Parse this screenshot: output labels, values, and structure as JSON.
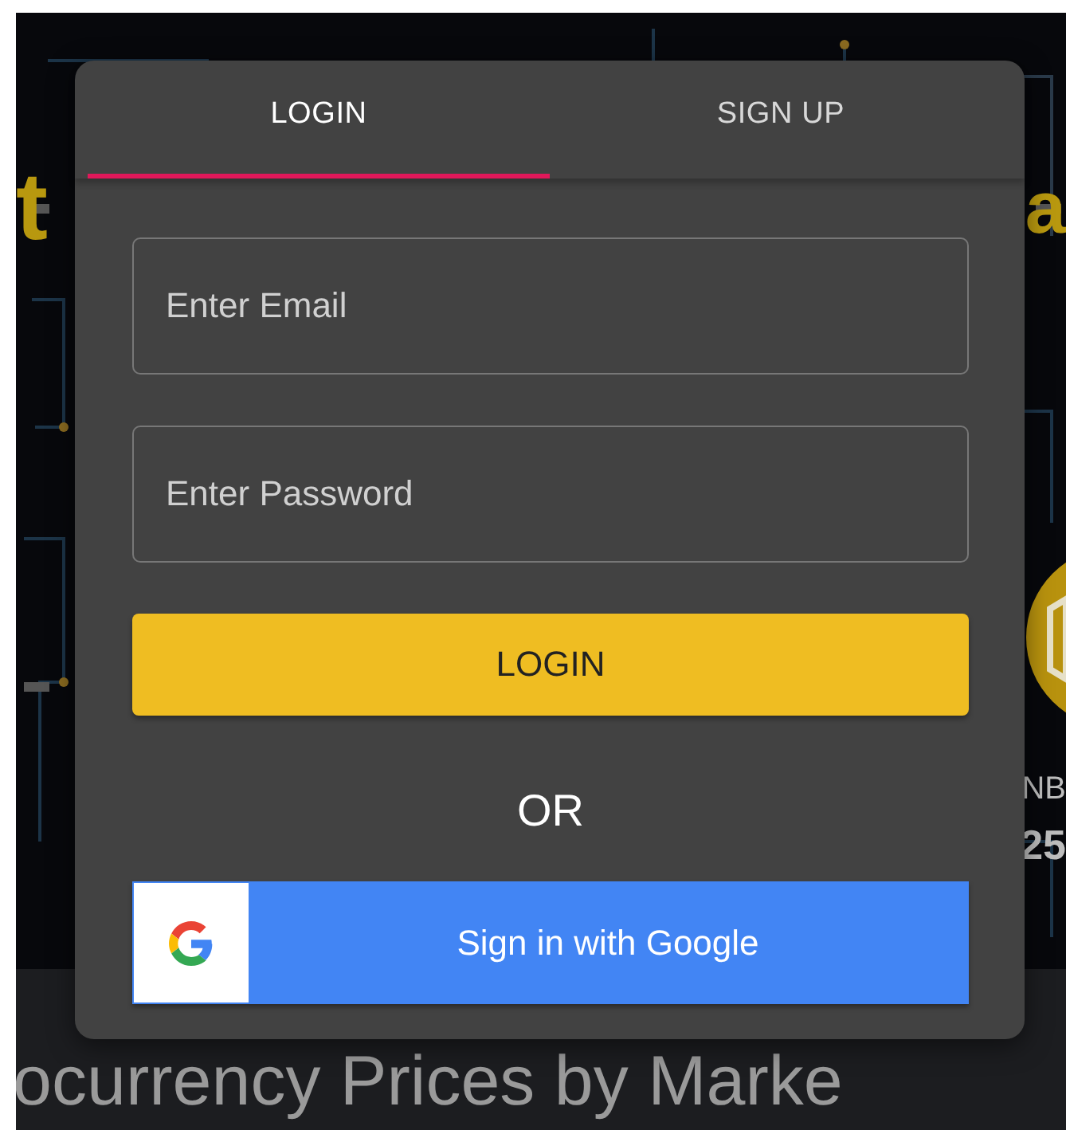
{
  "background": {
    "headline_left": "t",
    "headline_right": "a",
    "coin_label": "NB",
    "coin_value": "25",
    "banner": "ocurrency Prices by Marke"
  },
  "dialog": {
    "tabs": [
      {
        "label": "LOGIN",
        "selected": true
      },
      {
        "label": "SIGN UP",
        "selected": false
      }
    ],
    "email": {
      "placeholder": "Enter Email"
    },
    "password": {
      "placeholder": "Enter Password"
    },
    "login_button": "LOGIN",
    "separator": "OR",
    "google_button": "Sign in with Google"
  }
}
